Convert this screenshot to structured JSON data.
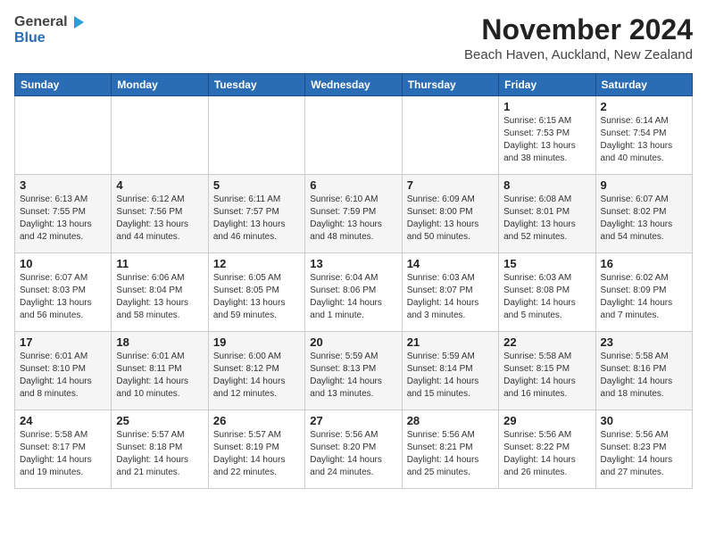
{
  "logo": {
    "general": "General",
    "blue": "Blue"
  },
  "title": "November 2024",
  "location": "Beach Haven, Auckland, New Zealand",
  "days_of_week": [
    "Sunday",
    "Monday",
    "Tuesday",
    "Wednesday",
    "Thursday",
    "Friday",
    "Saturday"
  ],
  "weeks": [
    [
      {
        "day": "",
        "info": ""
      },
      {
        "day": "",
        "info": ""
      },
      {
        "day": "",
        "info": ""
      },
      {
        "day": "",
        "info": ""
      },
      {
        "day": "",
        "info": ""
      },
      {
        "day": "1",
        "info": "Sunrise: 6:15 AM\nSunset: 7:53 PM\nDaylight: 13 hours\nand 38 minutes."
      },
      {
        "day": "2",
        "info": "Sunrise: 6:14 AM\nSunset: 7:54 PM\nDaylight: 13 hours\nand 40 minutes."
      }
    ],
    [
      {
        "day": "3",
        "info": "Sunrise: 6:13 AM\nSunset: 7:55 PM\nDaylight: 13 hours\nand 42 minutes."
      },
      {
        "day": "4",
        "info": "Sunrise: 6:12 AM\nSunset: 7:56 PM\nDaylight: 13 hours\nand 44 minutes."
      },
      {
        "day": "5",
        "info": "Sunrise: 6:11 AM\nSunset: 7:57 PM\nDaylight: 13 hours\nand 46 minutes."
      },
      {
        "day": "6",
        "info": "Sunrise: 6:10 AM\nSunset: 7:59 PM\nDaylight: 13 hours\nand 48 minutes."
      },
      {
        "day": "7",
        "info": "Sunrise: 6:09 AM\nSunset: 8:00 PM\nDaylight: 13 hours\nand 50 minutes."
      },
      {
        "day": "8",
        "info": "Sunrise: 6:08 AM\nSunset: 8:01 PM\nDaylight: 13 hours\nand 52 minutes."
      },
      {
        "day": "9",
        "info": "Sunrise: 6:07 AM\nSunset: 8:02 PM\nDaylight: 13 hours\nand 54 minutes."
      }
    ],
    [
      {
        "day": "10",
        "info": "Sunrise: 6:07 AM\nSunset: 8:03 PM\nDaylight: 13 hours\nand 56 minutes."
      },
      {
        "day": "11",
        "info": "Sunrise: 6:06 AM\nSunset: 8:04 PM\nDaylight: 13 hours\nand 58 minutes."
      },
      {
        "day": "12",
        "info": "Sunrise: 6:05 AM\nSunset: 8:05 PM\nDaylight: 13 hours\nand 59 minutes."
      },
      {
        "day": "13",
        "info": "Sunrise: 6:04 AM\nSunset: 8:06 PM\nDaylight: 14 hours\nand 1 minute."
      },
      {
        "day": "14",
        "info": "Sunrise: 6:03 AM\nSunset: 8:07 PM\nDaylight: 14 hours\nand 3 minutes."
      },
      {
        "day": "15",
        "info": "Sunrise: 6:03 AM\nSunset: 8:08 PM\nDaylight: 14 hours\nand 5 minutes."
      },
      {
        "day": "16",
        "info": "Sunrise: 6:02 AM\nSunset: 8:09 PM\nDaylight: 14 hours\nand 7 minutes."
      }
    ],
    [
      {
        "day": "17",
        "info": "Sunrise: 6:01 AM\nSunset: 8:10 PM\nDaylight: 14 hours\nand 8 minutes."
      },
      {
        "day": "18",
        "info": "Sunrise: 6:01 AM\nSunset: 8:11 PM\nDaylight: 14 hours\nand 10 minutes."
      },
      {
        "day": "19",
        "info": "Sunrise: 6:00 AM\nSunset: 8:12 PM\nDaylight: 14 hours\nand 12 minutes."
      },
      {
        "day": "20",
        "info": "Sunrise: 5:59 AM\nSunset: 8:13 PM\nDaylight: 14 hours\nand 13 minutes."
      },
      {
        "day": "21",
        "info": "Sunrise: 5:59 AM\nSunset: 8:14 PM\nDaylight: 14 hours\nand 15 minutes."
      },
      {
        "day": "22",
        "info": "Sunrise: 5:58 AM\nSunset: 8:15 PM\nDaylight: 14 hours\nand 16 minutes."
      },
      {
        "day": "23",
        "info": "Sunrise: 5:58 AM\nSunset: 8:16 PM\nDaylight: 14 hours\nand 18 minutes."
      }
    ],
    [
      {
        "day": "24",
        "info": "Sunrise: 5:58 AM\nSunset: 8:17 PM\nDaylight: 14 hours\nand 19 minutes."
      },
      {
        "day": "25",
        "info": "Sunrise: 5:57 AM\nSunset: 8:18 PM\nDaylight: 14 hours\nand 21 minutes."
      },
      {
        "day": "26",
        "info": "Sunrise: 5:57 AM\nSunset: 8:19 PM\nDaylight: 14 hours\nand 22 minutes."
      },
      {
        "day": "27",
        "info": "Sunrise: 5:56 AM\nSunset: 8:20 PM\nDaylight: 14 hours\nand 24 minutes."
      },
      {
        "day": "28",
        "info": "Sunrise: 5:56 AM\nSunset: 8:21 PM\nDaylight: 14 hours\nand 25 minutes."
      },
      {
        "day": "29",
        "info": "Sunrise: 5:56 AM\nSunset: 8:22 PM\nDaylight: 14 hours\nand 26 minutes."
      },
      {
        "day": "30",
        "info": "Sunrise: 5:56 AM\nSunset: 8:23 PM\nDaylight: 14 hours\nand 27 minutes."
      }
    ]
  ]
}
